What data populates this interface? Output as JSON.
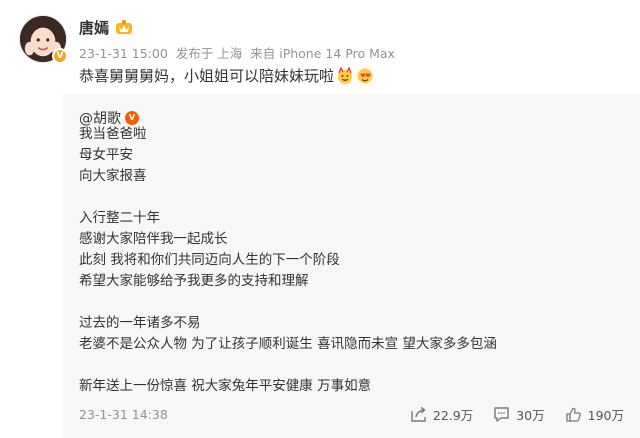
{
  "post": {
    "author": {
      "name": "唐嫣",
      "verified": true
    },
    "meta": {
      "time": "23-1-31 15:00",
      "location": "发布于 上海",
      "source": "来自 iPhone 14 Pro Max"
    },
    "text": "恭喜舅舅舅妈，小姐姐可以陪妹妹玩啦",
    "emojis": [
      "cheer-emoji-icon",
      "heart-face-emoji-icon"
    ]
  },
  "repost": {
    "author": "@胡歌",
    "lines": [
      "我当爸爸啦",
      "母女平安",
      "向大家报喜",
      "",
      "入行整二十年",
      "感谢大家陪伴我一起成长",
      "此刻 我将和你们共同迈向人生的下一个阶段",
      "希望大家能够给予我更多的支持和理解",
      "",
      "过去的一年诸多不易",
      "老婆不是公众人物 为了让孩子顺利诞生 喜讯隐而未宣 望大家多多包涵",
      "",
      "新年送上一份惊喜 祝大家兔年平安健康 万事如意"
    ],
    "time": "23-1-31 14:38",
    "actions": {
      "share": "22.9万",
      "comment": "30万",
      "like": "190万"
    }
  },
  "colors": {
    "meta": "#939393",
    "quote_bg": "#f7f7f7",
    "verified_orange": "#f5a623"
  }
}
